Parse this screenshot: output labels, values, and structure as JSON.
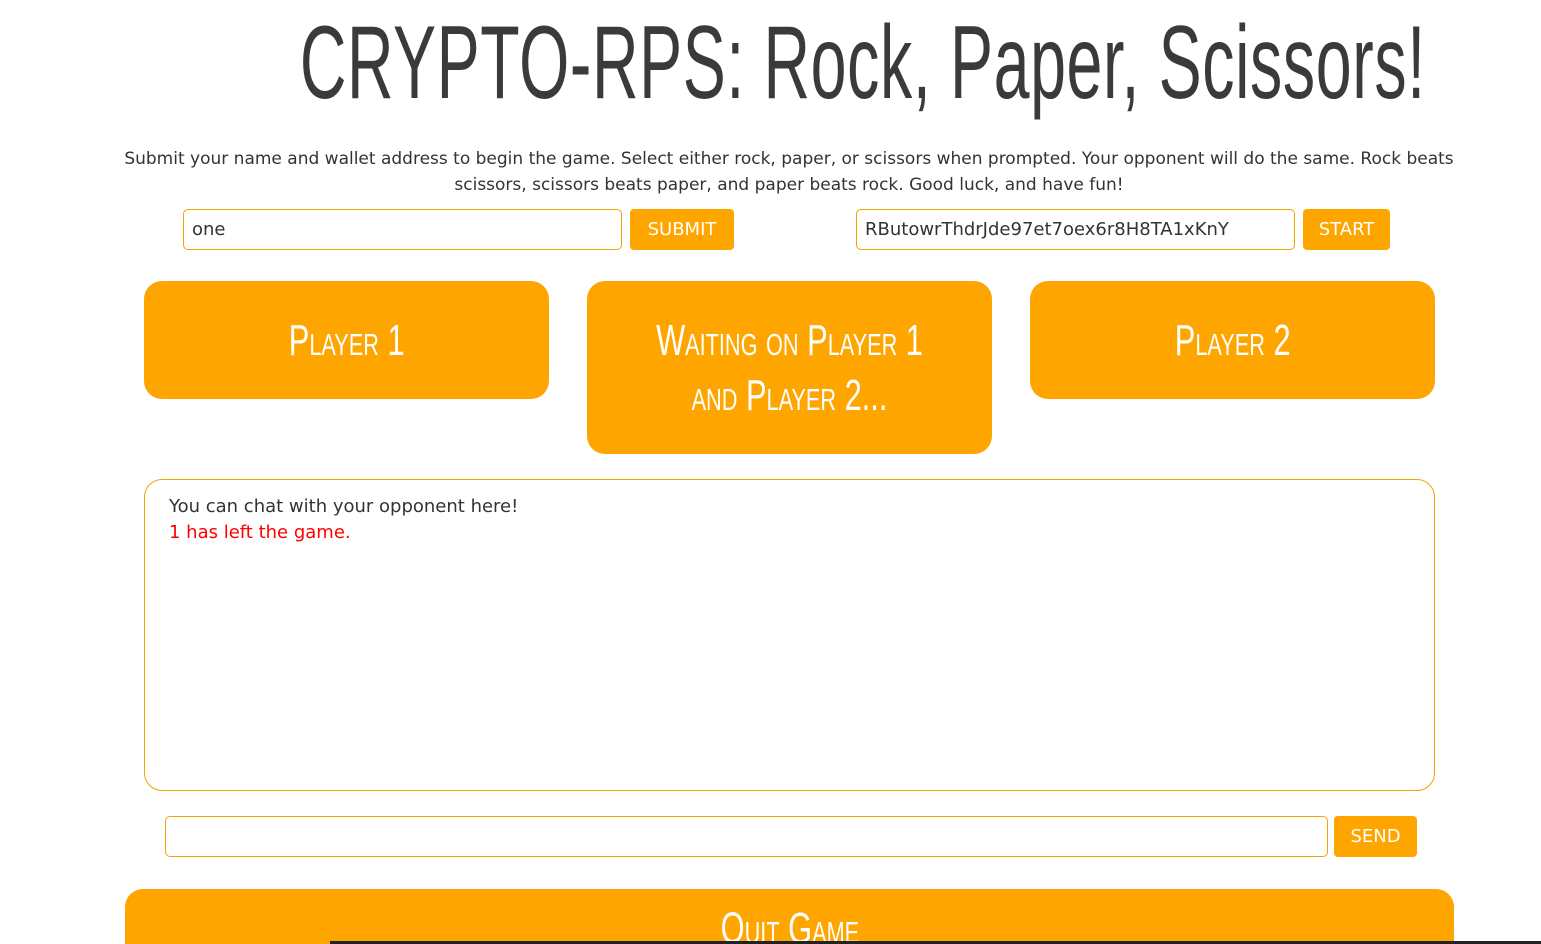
{
  "header": {
    "title": "CRYPTO-RPS: Rock, Paper, Scissors!",
    "instructions": "Submit your name and wallet address to begin the game. Select either rock, paper, or scissors when prompted. Your opponent will do the same. Rock beats scissors, scissors beats paper, and paper beats rock. Good luck, and have fun!"
  },
  "name_form": {
    "value": "one",
    "submit_label": "SUBMIT"
  },
  "wallet_form": {
    "value": "RButowrThdrJde97et7oex6r8H8TA1xKnY",
    "start_label": "START"
  },
  "players": {
    "player1": "Player 1",
    "status": "Waiting on Player 1 and Player 2...",
    "player2": "Player 2"
  },
  "chat": {
    "intro": "You can chat with your opponent here!",
    "messages": [
      "1 has left the game."
    ],
    "input_value": "",
    "send_label": "SEND"
  },
  "quit_label": "Quit Game",
  "colors": {
    "accent": "#ffa500",
    "text": "#333333",
    "alert": "#ff0000"
  }
}
